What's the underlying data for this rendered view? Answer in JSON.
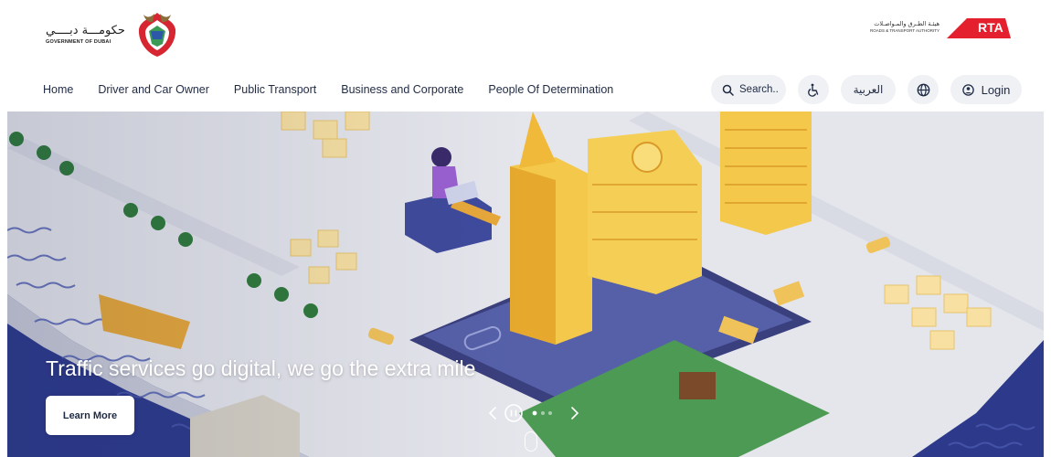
{
  "header": {
    "gov_logo": {
      "arabic_text": "حكومـــة دبــــي",
      "english_text": "GOVERNMENT OF DUBAI"
    },
    "rta_logo": {
      "arabic_text": "هيئـة الطـرق والمـواصـلات",
      "english_text": "ROADS & TRANSPORT AUTHORITY",
      "mark_text": "RTA"
    }
  },
  "nav": {
    "items": [
      {
        "label": "Home"
      },
      {
        "label": "Driver and Car Owner"
      },
      {
        "label": "Public Transport"
      },
      {
        "label": "Business and Corporate"
      },
      {
        "label": "People Of Determination"
      }
    ],
    "search_placeholder": "Search..",
    "accessibility_icon": "wheelchair-icon",
    "language_label": "العربية",
    "globe_icon": "globe-icon",
    "login_label": "Login",
    "login_icon": "user-circle-icon"
  },
  "hero": {
    "title": "Traffic services go digital, we go the extra mile",
    "button_label": "Learn More",
    "slider": {
      "prev_icon": "chevron-left-icon",
      "pause_icon": "pause-circle-icon",
      "next_icon": "chevron-right-icon",
      "slide_count": 3,
      "active_slide": 1
    },
    "scroll_indicator_icon": "mouse-scroll-icon"
  },
  "colors": {
    "nav_text": "#1f2a44",
    "pill_bg": "#f0f1f4",
    "rta_red": "#e5202e",
    "water": "#2d3a8c",
    "building_gold": "#f3c84b"
  }
}
